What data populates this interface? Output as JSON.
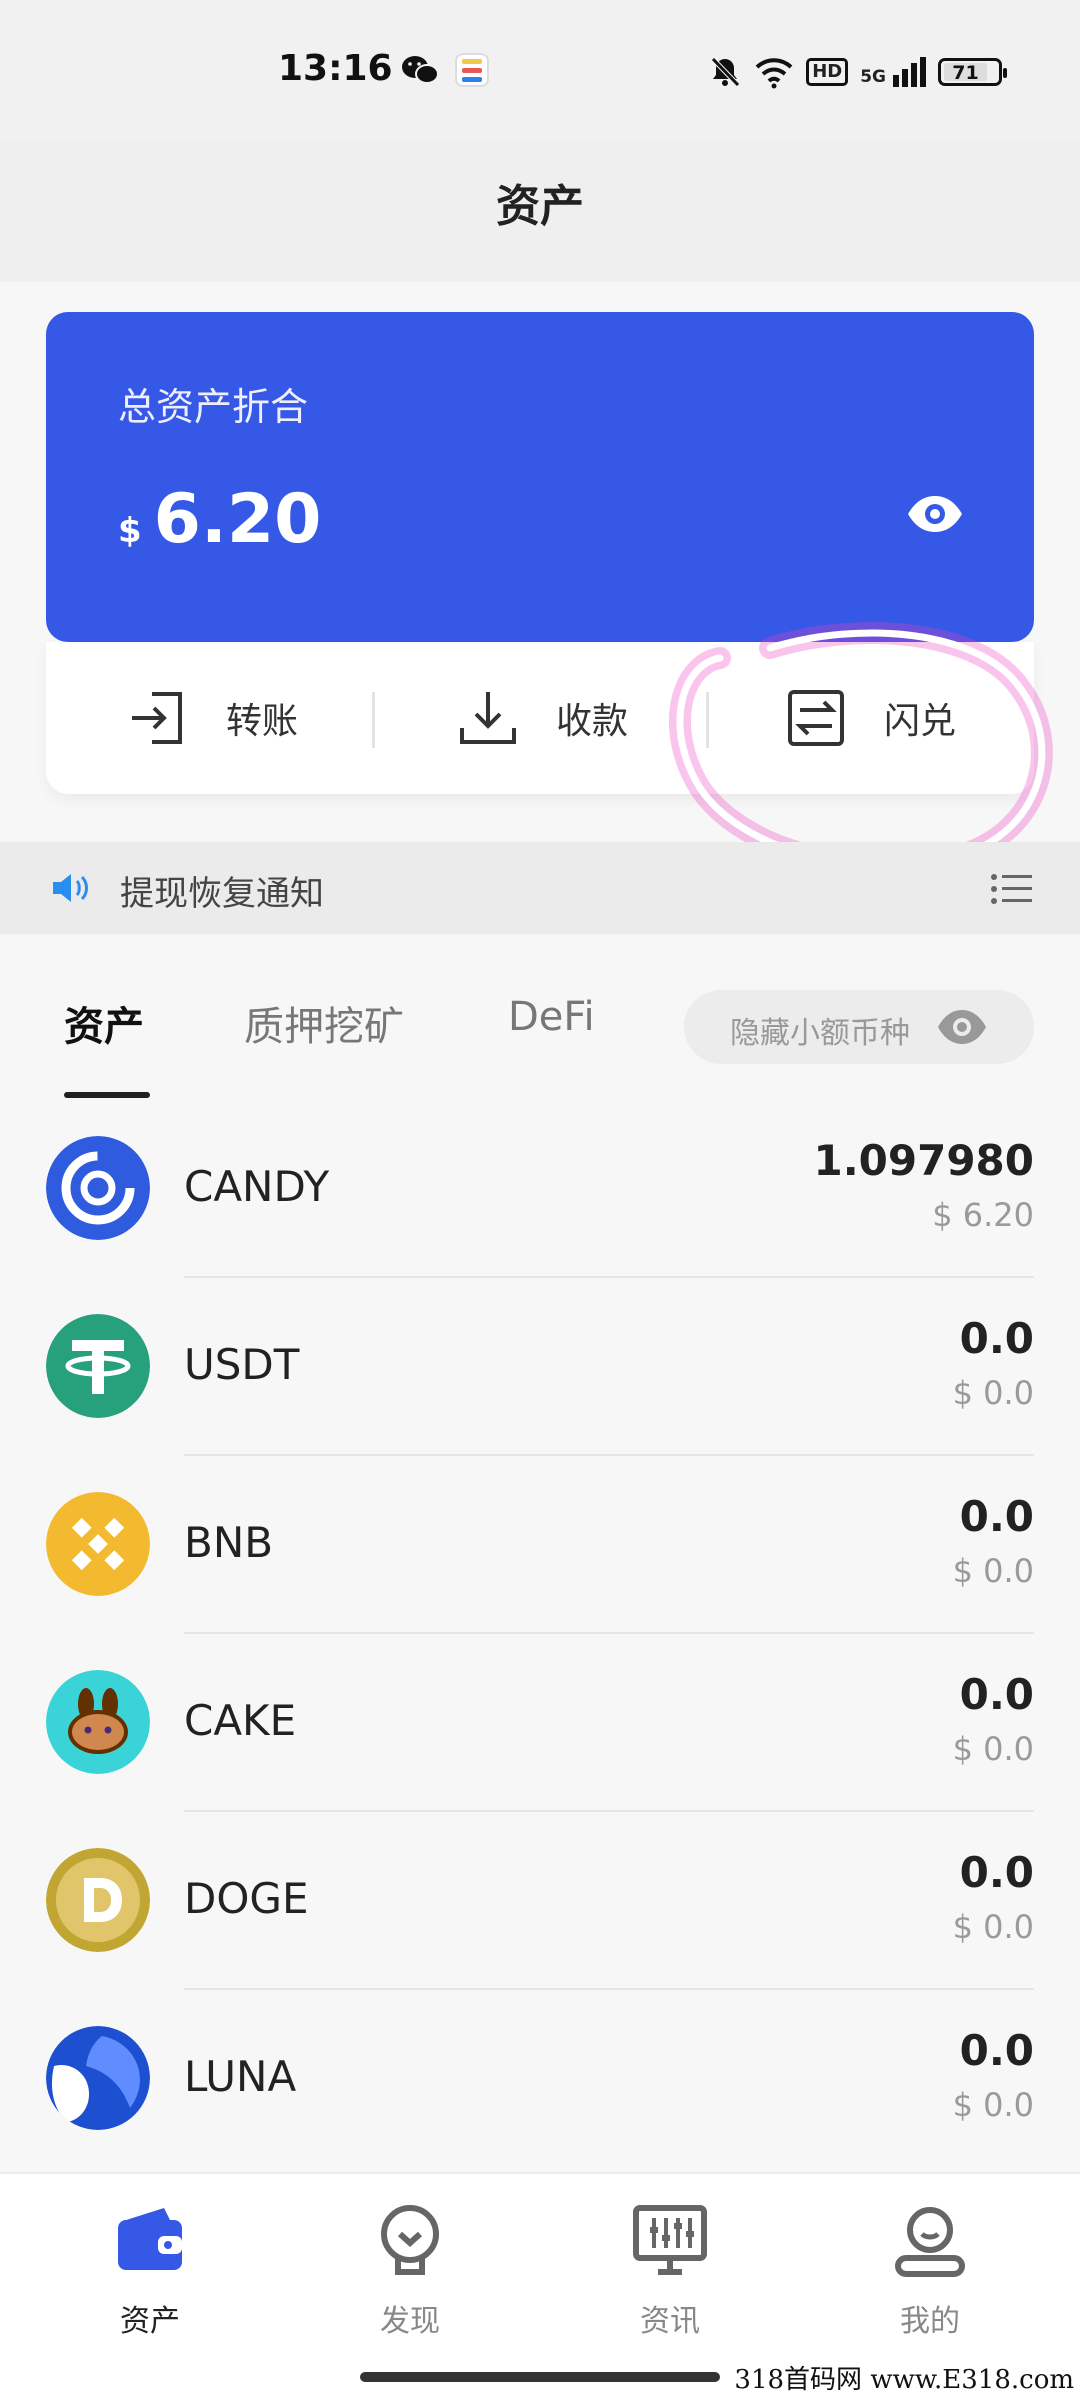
{
  "status_bar": {
    "time": "13:16",
    "network": "HD",
    "signal": "5G",
    "battery": "71"
  },
  "header": {
    "title": "资产"
  },
  "asset_card": {
    "label": "总资产折合",
    "currency": "$",
    "amount": "6.20"
  },
  "actions": [
    {
      "label": "转账",
      "icon": "transfer-in-icon"
    },
    {
      "label": "收款",
      "icon": "download-icon"
    },
    {
      "label": "闪兑",
      "icon": "swap-icon"
    }
  ],
  "notice": {
    "text": "提现恢复通知"
  },
  "tabs": [
    {
      "label": "资产",
      "active": true
    },
    {
      "label": "质押挖矿",
      "active": false
    },
    {
      "label": "DeFi",
      "active": false
    }
  ],
  "hide_small": {
    "label": "隐藏小额币种"
  },
  "tokens": [
    {
      "name": "CANDY",
      "amount": "1.097980",
      "value": "$ 6.20",
      "color": "#2f5bde"
    },
    {
      "name": "USDT",
      "amount": "0.0",
      "value": "$ 0.0",
      "color": "#26a17b"
    },
    {
      "name": "BNB",
      "amount": "0.0",
      "value": "$ 0.0",
      "color": "#f3ba2f"
    },
    {
      "name": "CAKE",
      "amount": "0.0",
      "value": "$ 0.0",
      "color": "#3ad3d8"
    },
    {
      "name": "DOGE",
      "amount": "0.0",
      "value": "$ 0.0",
      "color": "#c2a633"
    },
    {
      "name": "LUNA",
      "amount": "0.0",
      "value": "$ 0.0",
      "color": "#1d4fd1"
    }
  ],
  "bottom_nav": [
    {
      "label": "资产",
      "icon": "wallet-icon",
      "active": true
    },
    {
      "label": "发现",
      "icon": "bulb-icon",
      "active": false
    },
    {
      "label": "资讯",
      "icon": "monitor-icon",
      "active": false
    },
    {
      "label": "我的",
      "icon": "user-icon",
      "active": false
    }
  ],
  "watermark": "318首码网 www.E318.com",
  "colors": {
    "accent": "#3558e6",
    "highlight": "#ee3fc0"
  }
}
